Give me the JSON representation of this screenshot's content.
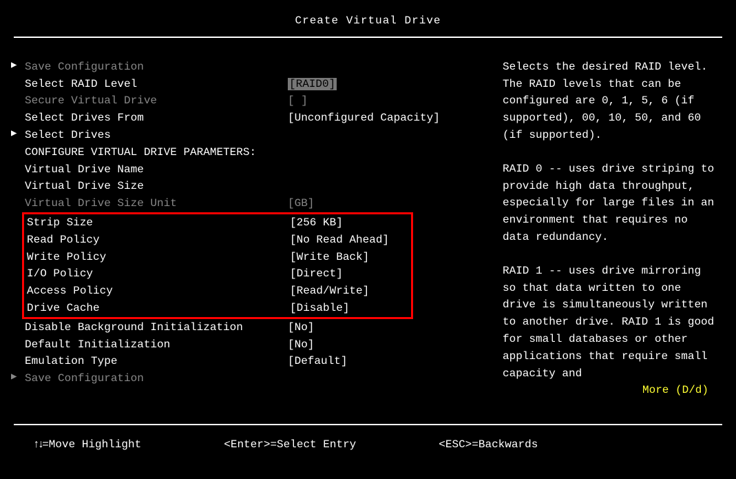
{
  "title": "Create Virtual Drive",
  "menu": {
    "save_config_top": "Save Configuration",
    "select_raid_level": {
      "label": "Select RAID Level",
      "value": "[RAID0]"
    },
    "secure_vd": {
      "label": "Secure Virtual Drive",
      "value": "[ ]"
    },
    "select_drives_from": {
      "label": "Select Drives From",
      "value": "[Unconfigured Capacity]"
    },
    "select_drives": "Select Drives",
    "section_header": "CONFIGURE VIRTUAL DRIVE PARAMETERS:",
    "vd_name": {
      "label": "Virtual Drive Name",
      "value": ""
    },
    "vd_size": {
      "label": "Virtual Drive Size",
      "value": ""
    },
    "vd_size_unit": {
      "label": "Virtual Drive Size Unit",
      "value": "[GB]"
    },
    "strip_size": {
      "label": "Strip Size",
      "value": "[256 KB]"
    },
    "read_policy": {
      "label": "Read Policy",
      "value": "[No Read Ahead]"
    },
    "write_policy": {
      "label": "Write Policy",
      "value": "[Write Back]"
    },
    "io_policy": {
      "label": "I/O Policy",
      "value": "[Direct]"
    },
    "access_policy": {
      "label": "Access Policy",
      "value": "[Read/Write]"
    },
    "drive_cache": {
      "label": "Drive Cache",
      "value": "[Disable]"
    },
    "disable_bgi": {
      "label": "Disable Background Initialization",
      "value": "[No]"
    },
    "default_init": {
      "label": "Default Initialization",
      "value": "[No]"
    },
    "emulation": {
      "label": "Emulation Type",
      "value": "[Default]"
    },
    "save_config_bottom": "Save Configuration"
  },
  "help": {
    "p1": "Selects the desired RAID level. The RAID levels that can be configured are 0, 1, 5, 6 (if supported), 00, 10, 50, and 60 (if supported).",
    "p2": "RAID 0 -- uses drive striping to provide high data throughput, especially for large files in an environment that requires no data redundancy.",
    "p3": "RAID 1 -- uses drive mirroring so that data written to one drive is simultaneously written to another drive. RAID 1 is good for small databases or other applications that require small capacity and",
    "more": "More (D/d)"
  },
  "footer": {
    "move": "=Move Highlight",
    "select": "<Enter>=Select Entry",
    "back": "<ESC>=Backwards"
  }
}
